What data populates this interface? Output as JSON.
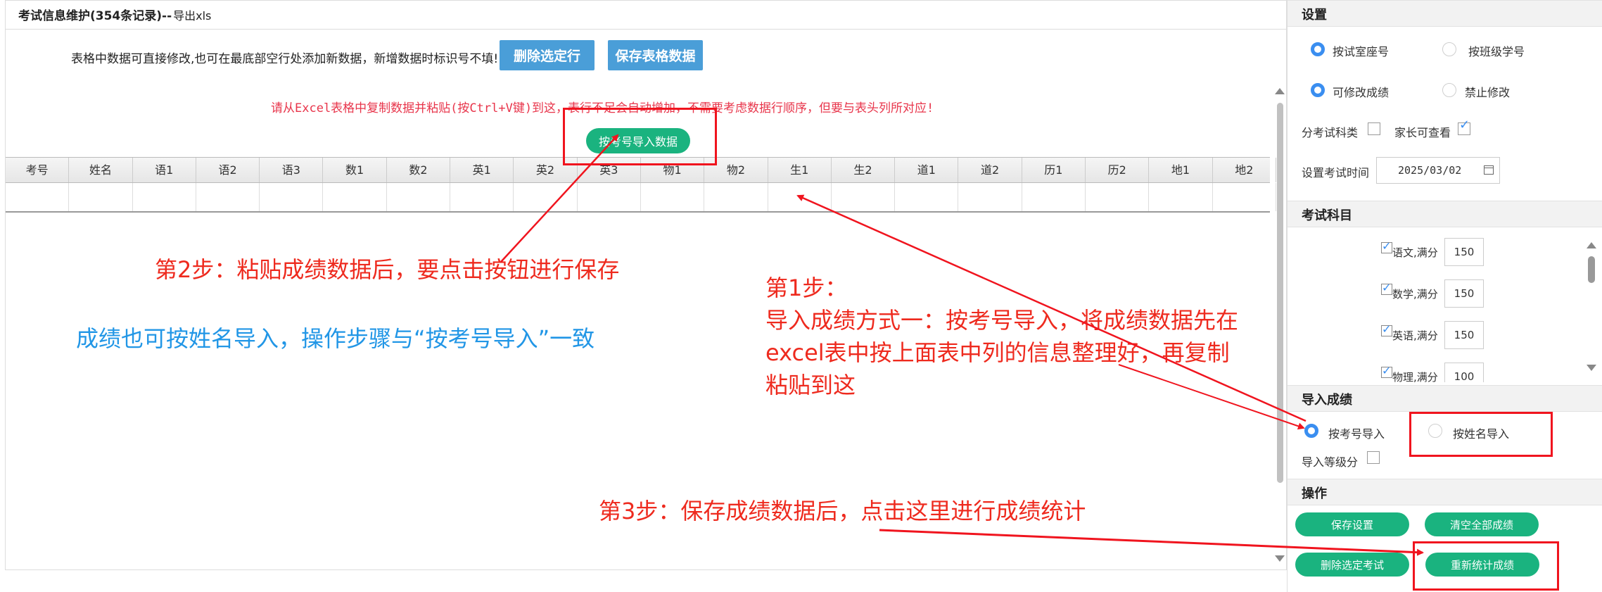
{
  "main": {
    "title": "考试信息维护(354条记录)--",
    "export_link": "导出xls",
    "info_text": "表格中数据可直接修改,也可在最底部空行处添加新数据，新增数据时标识号不填!",
    "delete_row_button": "删除选定行",
    "save_table_button": "保存表格数据",
    "paste_hint": "请从Excel表格中复制数据并粘贴(按Ctrl+V键)到这，表行不足会自动增加，不需要考虑数据行顺序，但要与表头列所对应!",
    "import_by_number_button": "按考号导入数据",
    "columns": [
      "考号",
      "姓名",
      "语1",
      "语2",
      "语3",
      "数1",
      "数2",
      "英1",
      "英2",
      "英3",
      "物1",
      "物2",
      "生1",
      "生2",
      "道1",
      "道2",
      "历1",
      "历2",
      "地1",
      "地2"
    ]
  },
  "annotations": {
    "step2": "第2步：粘贴成绩数据后，要点击按钮进行保存",
    "by_name": "成绩也可按姓名导入，操作步骤与“按考号导入”一致",
    "step1_lines": [
      "第1步：",
      "导入成绩方式一：按考号导入，将成绩数据先在",
      "excel表中按上面表中列的信息整理好，再复制",
      "粘贴到这"
    ],
    "step3": "第3步：保存成绩数据后，点击这里进行成绩统计"
  },
  "settings": {
    "title": "设置",
    "order_options": [
      {
        "label": "按试室座号",
        "selected": true
      },
      {
        "label": "按班级学号",
        "selected": false
      }
    ],
    "edit_options": [
      {
        "label": "可修改成绩",
        "selected": true
      },
      {
        "label": "禁止修改",
        "selected": false
      }
    ],
    "by_subject_label": "分考试科类",
    "by_subject_checked": false,
    "parent_view_label": "家长可查看",
    "parent_view_checked": true,
    "exam_time_label": "设置考试时间",
    "exam_time_value": "2025/03/02"
  },
  "subjects": {
    "title": "考试科目",
    "items": [
      {
        "label": "语文,满分",
        "score": "150",
        "checked": true
      },
      {
        "label": "数学,满分",
        "score": "150",
        "checked": true
      },
      {
        "label": "英语,满分",
        "score": "150",
        "checked": true
      },
      {
        "label": "物理,满分",
        "score": "100",
        "checked": true
      }
    ]
  },
  "import": {
    "title": "导入成绩",
    "options": [
      {
        "label": "按考号导入",
        "selected": true
      },
      {
        "label": "按姓名导入",
        "selected": false
      }
    ],
    "grade_label": "导入等级分",
    "grade_checked": false
  },
  "operations": {
    "title": "操作",
    "save_settings": "保存设置",
    "clear_all": "清空全部成绩",
    "delete_exam": "删除选定考试",
    "recalc": "重新统计成绩"
  },
  "colors": {
    "accent_blue": "#4a9ed8",
    "green": "#1ab37f",
    "annotation_red": "#ee2a1e",
    "annotation_blue": "#2196e6",
    "radio_blue": "#3a8ef0"
  }
}
